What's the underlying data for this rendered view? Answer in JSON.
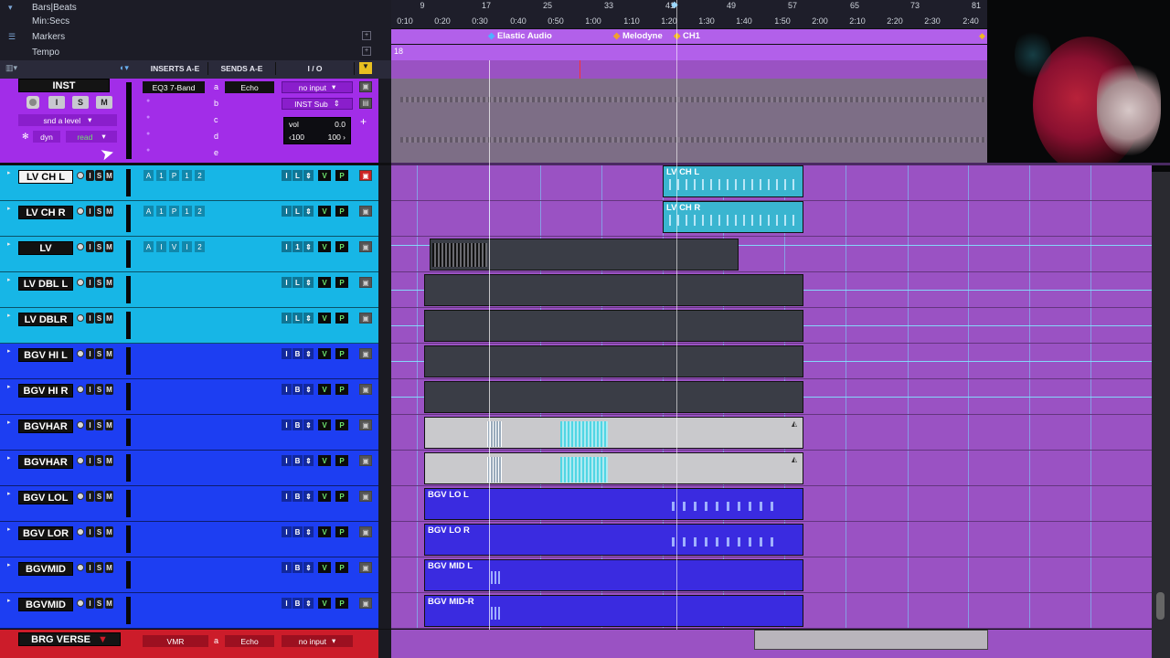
{
  "rulers": [
    {
      "label": "Bars|Beats",
      "icon": "triangle-down-icon"
    },
    {
      "label": "Min:Secs",
      "icon": ""
    },
    {
      "label": "Markers",
      "icon": "list-icon"
    },
    {
      "label": "Tempo",
      "icon": ""
    }
  ],
  "bars": [
    "9",
    "17",
    "25",
    "33",
    "41",
    "49",
    "57",
    "65",
    "73",
    "81"
  ],
  "times": [
    "0:10",
    "0:20",
    "0:30",
    "0:40",
    "0:50",
    "1:00",
    "1:10",
    "1:20",
    "1:30",
    "1:40",
    "1:50",
    "2:00",
    "2:10",
    "2:20",
    "2:30",
    "2:40"
  ],
  "markers": [
    "Elastic Audio",
    "Melodyne",
    "CH1"
  ],
  "tempo_value": "18",
  "columns": {
    "inserts": "INSERTS A-E",
    "sends": "SENDS A-E",
    "io": "I / O"
  },
  "inst": {
    "name": "INST",
    "solo": "S",
    "mute": "M",
    "input": "I",
    "insert_a": "EQ3 7-Band",
    "send_letters": [
      "a",
      "b",
      "c",
      "d",
      "e"
    ],
    "send_a": "Echo",
    "input_sel": "no input",
    "output_sel": "INST Sub",
    "level_label": "snd a level",
    "dyn": "dyn",
    "read": "read",
    "vol_label": "vol",
    "vol_value": "0.0",
    "pan_l": "‹100",
    "pan_r": "100 ›"
  },
  "tracks": [
    {
      "name": "LV CH L",
      "selected": true,
      "color": "#17b6e6",
      "ins": [
        "A",
        "1",
        "P",
        "1",
        "2"
      ],
      "io": [
        "I",
        "L",
        "⇕"
      ]
    },
    {
      "name": "LV CH R",
      "selected": false,
      "color": "#17b6e6",
      "ins": [
        "A",
        "1",
        "P",
        "1",
        "2"
      ],
      "io": [
        "I",
        "L",
        "⇕"
      ]
    },
    {
      "name": "LV",
      "selected": false,
      "color": "#17b6e6",
      "ins": [
        "A",
        "I",
        "V",
        "I",
        "2"
      ],
      "io": [
        "I",
        "1",
        "⇕"
      ]
    },
    {
      "name": "LV DBL L",
      "selected": false,
      "color": "#17b6e6",
      "ins": [],
      "io": [
        "I",
        "L",
        "⇕"
      ]
    },
    {
      "name": "LV DBLR",
      "selected": false,
      "color": "#17b6e6",
      "ins": [],
      "io": [
        "I",
        "L",
        "⇕"
      ]
    },
    {
      "name": "BGV HI L",
      "selected": false,
      "color": "#1d3ef2",
      "ins": [],
      "io": [
        "I",
        "B",
        "⇕"
      ]
    },
    {
      "name": "BGV HI R",
      "selected": false,
      "color": "#1d3ef2",
      "ins": [],
      "io": [
        "I",
        "B",
        "⇕"
      ]
    },
    {
      "name": "BGVHAR",
      "selected": false,
      "color": "#1d3ef2",
      "ins": [],
      "io": [
        "I",
        "B",
        "⇕"
      ]
    },
    {
      "name": "BGVHAR",
      "selected": false,
      "color": "#1d3ef2",
      "ins": [],
      "io": [
        "I",
        "B",
        "⇕"
      ]
    },
    {
      "name": "BGV LOL",
      "selected": false,
      "color": "#1d3ef2",
      "ins": [],
      "io": [
        "I",
        "B",
        "⇕"
      ]
    },
    {
      "name": "BGV LOR",
      "selected": false,
      "color": "#1d3ef2",
      "ins": [],
      "io": [
        "I",
        "B",
        "⇕"
      ]
    },
    {
      "name": "BGVMID",
      "selected": false,
      "color": "#1d3ef2",
      "ins": [],
      "io": [
        "I",
        "B",
        "⇕"
      ]
    },
    {
      "name": "BGVMID",
      "selected": false,
      "color": "#1d3ef2",
      "ins": [],
      "io": [
        "I",
        "B",
        "⇕"
      ]
    }
  ],
  "track_buttons": {
    "i": "I",
    "s": "S",
    "m": "M",
    "v": "V",
    "p": "P"
  },
  "clips": {
    "lv_ch_l": "LV CH L",
    "lv_ch_r": "LV CH R",
    "bgv_lo_l": "BGV LO L",
    "bgv_lo_r": "BGV LO R",
    "bgv_mid_l": "BGV MID L",
    "bgv_mid_r": "BGV MID-R"
  },
  "brg": {
    "name": "BRG VERSE",
    "insert": "VMR",
    "send_letter": "a",
    "send": "Echo",
    "input": "no input"
  },
  "colors": {
    "purple": "#a22de8",
    "cyan": "#17b6e6",
    "blue": "#1d3ef2",
    "red": "#cc1c2a",
    "lane": "#9a52c3"
  }
}
